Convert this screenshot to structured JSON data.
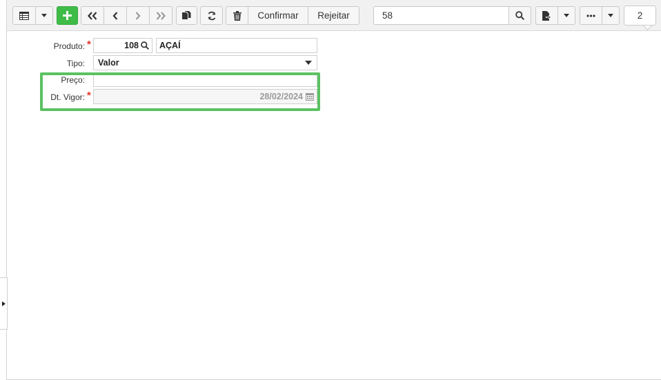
{
  "toolbar": {
    "confirm_label": "Confirmar",
    "reject_label": "Rejeitar",
    "search_value": "58",
    "record_count": "2",
    "add_button_color": "#3fbc48"
  },
  "form": {
    "product": {
      "label": "Produto:",
      "required_mark": "*",
      "code": "108",
      "name": "AÇAÍ"
    },
    "type": {
      "label": "Tipo:",
      "value": "Valor"
    },
    "price": {
      "label": "Preço:",
      "value": ""
    },
    "effective_date": {
      "label": "Dt. Vigor:",
      "required_mark": "*",
      "value": "28/02/2024"
    }
  },
  "highlight_color": "#5cc163"
}
